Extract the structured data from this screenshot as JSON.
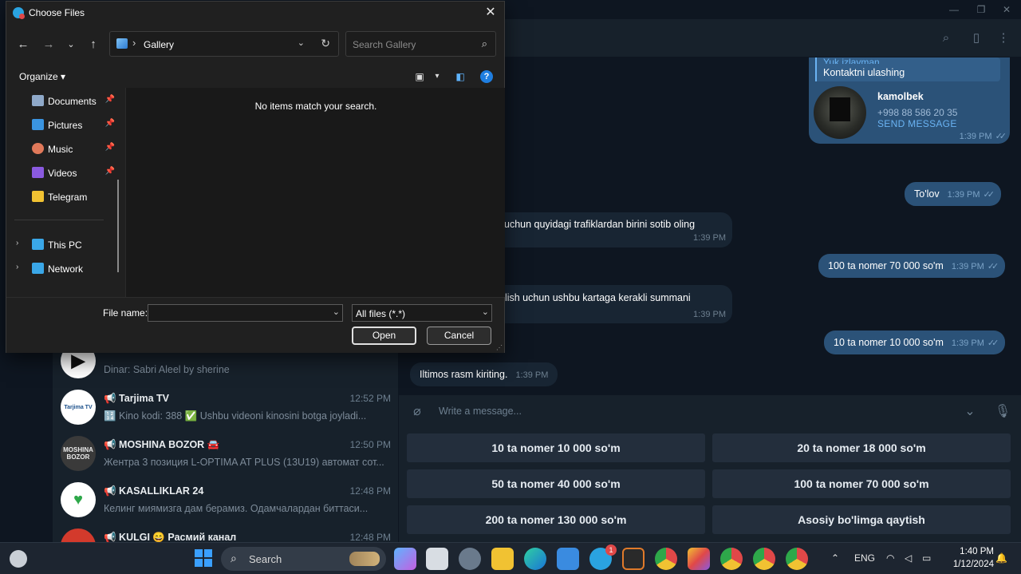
{
  "telegram": {
    "header_icons": [
      "search-icon",
      "sidebar-toggle-icon",
      "more-vertical-icon"
    ],
    "window_controls": [
      "minimize-icon",
      "restore-icon",
      "close-icon"
    ],
    "chats": [
      {
        "name": "",
        "time": "",
        "preview": "Dinar: Sabri Aleel by sherine",
        "avatar_color": "#ffffff"
      },
      {
        "name": "📢 Tarjima TV",
        "time": "12:52 PM",
        "preview": "🔢 Kino kodi: 388  ✅ Ushbu videoni kinosini botga joyladi...",
        "avatar_text": "Tarjima TV",
        "avatar_color": "#ffffff"
      },
      {
        "name": "📢 MOSHINA BOZOR 🚘",
        "time": "12:50 PM",
        "preview": "Жентра 3 позиция L-OPTIMA AT PLUS (13U19) автомат сот...",
        "avatar_text": "MOSHINA BOZOR",
        "avatar_color": "#3a3a3a"
      },
      {
        "name": "📢 KASALLIKLAR 24",
        "time": "12:48 PM",
        "preview": "Келинг миямизга дам берамиз.  Одамчалардан биттаси...",
        "avatar_color": "#ffffff"
      },
      {
        "name": "📢 KULGI 😄 Расмий канал",
        "time": "12:48 PM",
        "preview": "",
        "avatar_color": "#d33a2c"
      }
    ],
    "contact_card": {
      "quote_name": "Yuk izlayman",
      "quote_text": "Kontaktni ulashing",
      "name": "kamolbek",
      "phone": "+998 88 586 20 35",
      "action": "SEND MESSAGE",
      "time": "1:39 PM"
    },
    "messages": [
      {
        "dir": "out",
        "text": "To'lov",
        "time": "1:39 PM"
      },
      {
        "dir": "in",
        "text": "uchun quyidagi trafiklardan birini sotib oling",
        "time": "1:39 PM"
      },
      {
        "dir": "out",
        "text": "100 ta nomer 70 000 so'm",
        "time": "1:39 PM"
      },
      {
        "dir": "in",
        "text": "olish uchun ushbu kartaga kerakli summani",
        "time": "1:39 PM"
      },
      {
        "dir": "out",
        "text": "10 ta nomer 10 000 so'm",
        "time": "1:39 PM"
      },
      {
        "dir": "in",
        "text": "Iltimos rasm kiriting.",
        "time": "1:39 PM"
      }
    ],
    "compose": {
      "placeholder": "Write a message..."
    },
    "keyboard": [
      "10 ta nomer 10 000 so'm",
      "20 ta nomer 18 000 so'm",
      "50 ta nomer 40 000 so'm",
      "100 ta nomer 70 000 so'm",
      "200 ta nomer 130 000 so'm",
      "Asosiy bo'limga qaytish"
    ]
  },
  "dialog": {
    "title": "Choose Files",
    "address": {
      "separator": "›",
      "location": "Gallery"
    },
    "search_placeholder": "Search Gallery",
    "organize_label": "Organize",
    "nav_items": [
      {
        "label": "Documents",
        "icon": "documents-icon",
        "color": "#8fa9c9",
        "pinned": true
      },
      {
        "label": "Pictures",
        "icon": "pictures-icon",
        "color": "#3a94e0",
        "pinned": true
      },
      {
        "label": "Music",
        "icon": "music-icon",
        "color": "#e0795a",
        "pinned": true
      },
      {
        "label": "Videos",
        "icon": "videos-icon",
        "color": "#8a5ae0",
        "pinned": true
      },
      {
        "label": "Telegram",
        "icon": "folder-icon",
        "color": "#f1c232",
        "pinned": false
      },
      {
        "label": "This PC",
        "icon": "computer-icon",
        "color": "#3aa7e8",
        "pinned": false
      },
      {
        "label": "Network",
        "icon": "network-icon",
        "color": "#3aa7e8",
        "pinned": false
      }
    ],
    "empty_message": "No items match your search.",
    "file_name_label": "File name:",
    "file_name_value": "",
    "file_type": "All files (*.*)",
    "open_label": "Open",
    "cancel_label": "Cancel"
  },
  "taskbar": {
    "search_label": "Search",
    "telegram_badge": "1",
    "language": "ENG",
    "time": "1:40 PM",
    "date": "1/12/2024"
  }
}
